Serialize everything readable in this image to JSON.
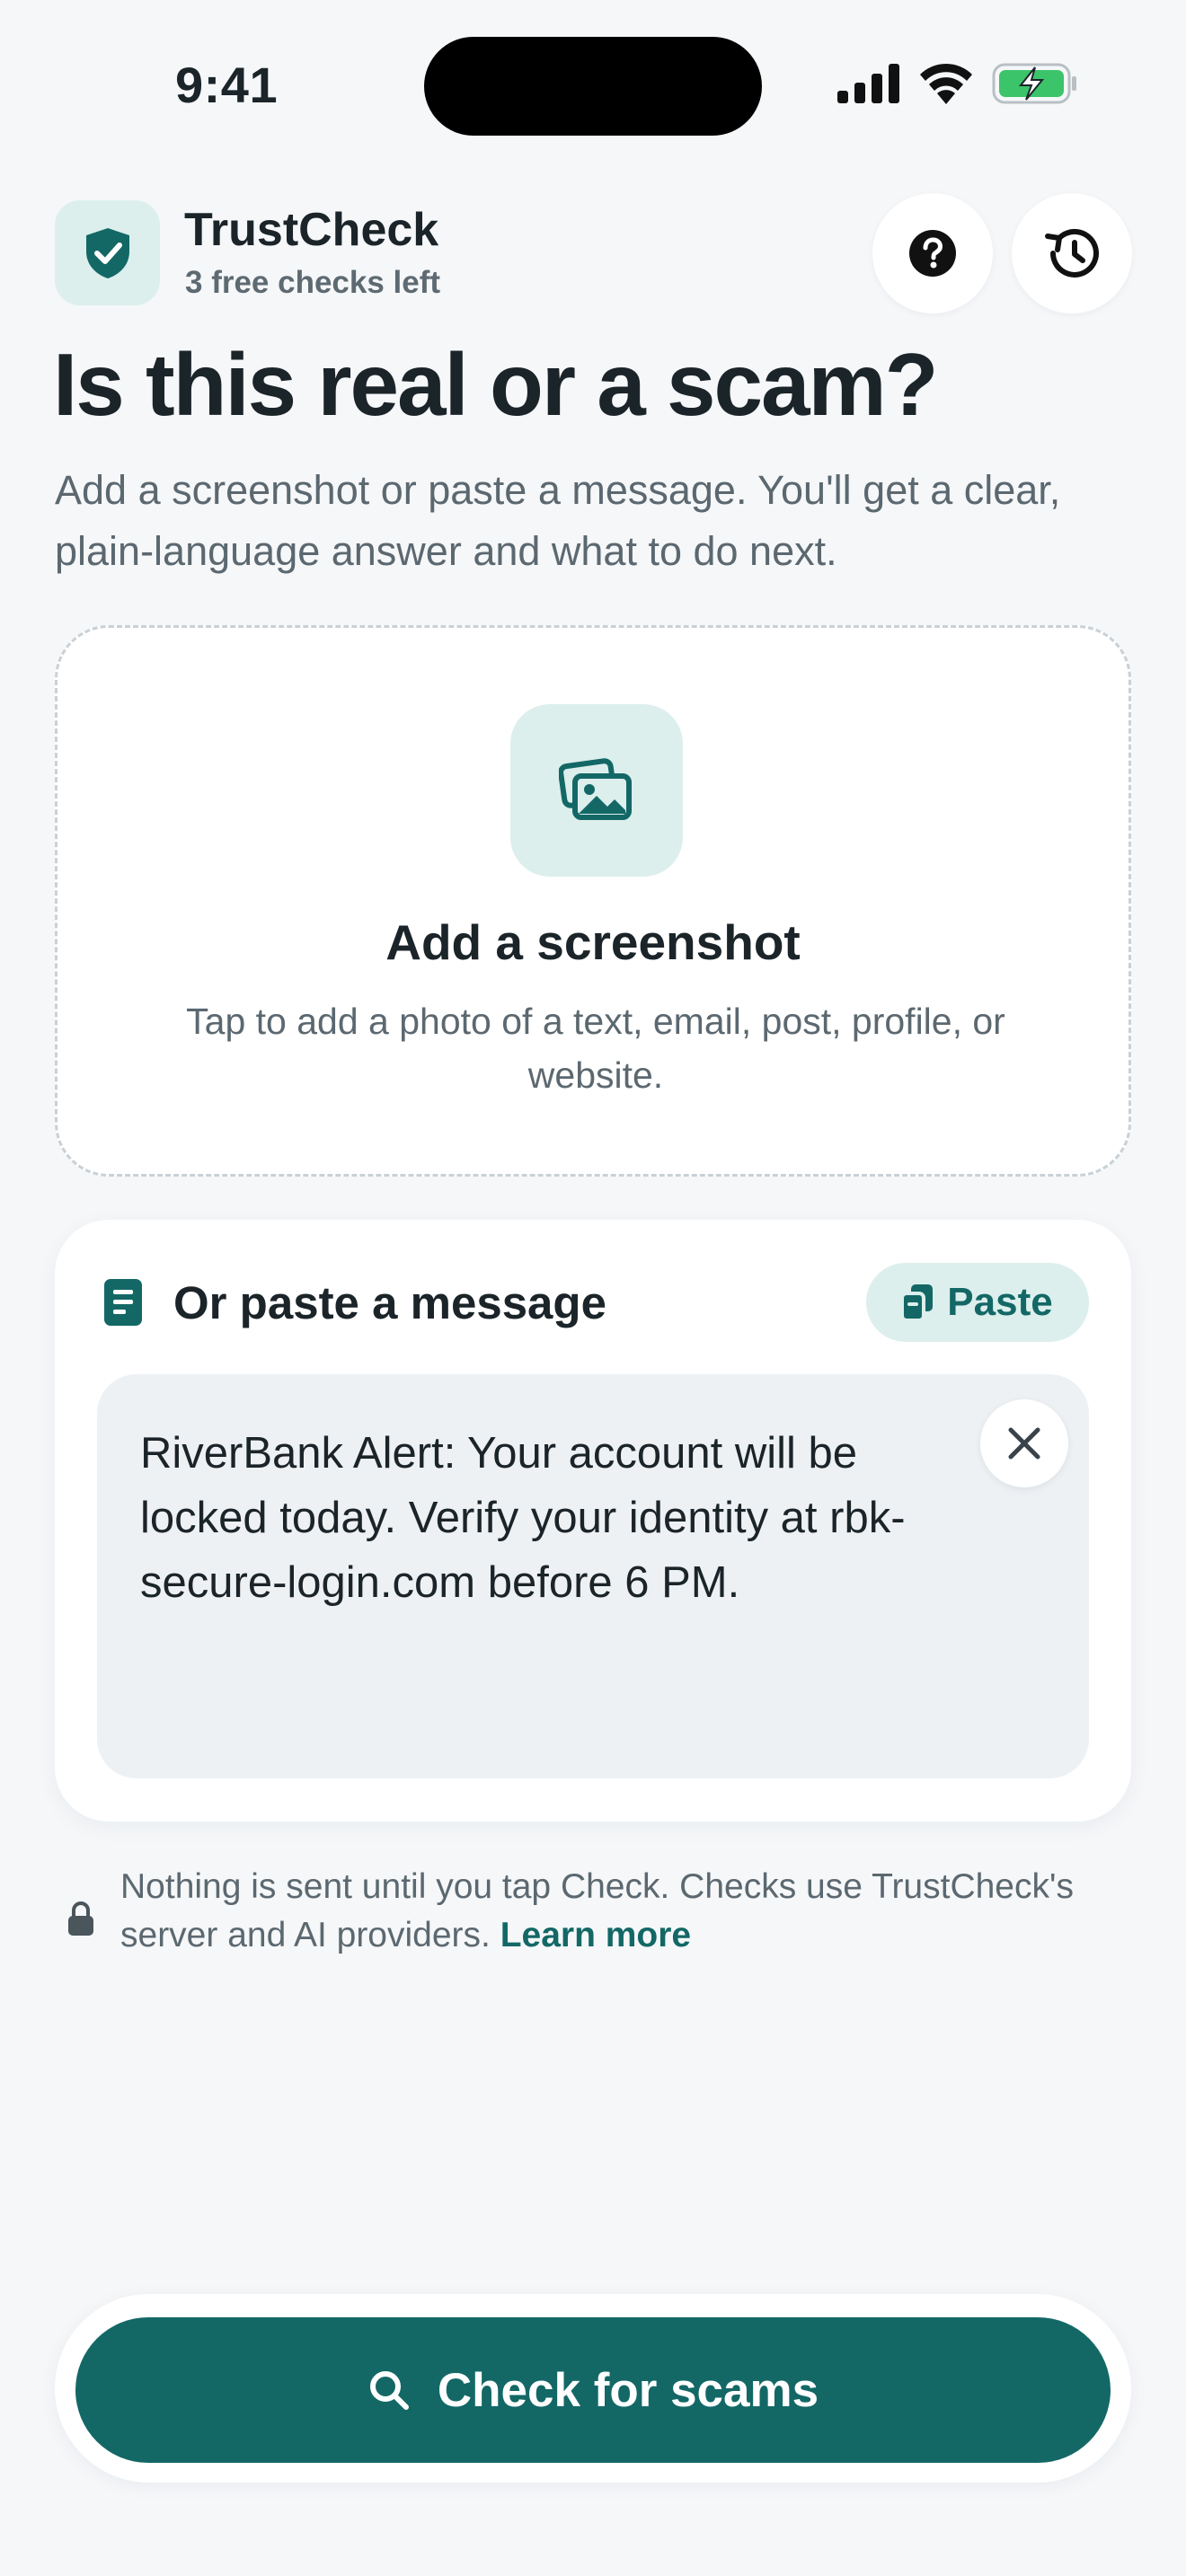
{
  "status_bar": {
    "time": "9:41"
  },
  "header": {
    "app_name": "TrustCheck",
    "subtitle": "3 free checks left",
    "logo_icon": "shield-check-icon",
    "help_icon": "question-circle-icon",
    "history_icon": "history-clock-icon"
  },
  "main": {
    "headline": "Is this real or a scam?",
    "intro": "Add a screenshot or paste a message. You'll get a clear, plain-language answer and what to do next."
  },
  "upload": {
    "icon": "photos-icon",
    "title": "Add a screenshot",
    "description": "Tap to add a photo of a text, email, post, profile, or website."
  },
  "paste": {
    "icon": "document-icon",
    "title": "Or paste a message",
    "paste_label": "Paste",
    "message": "RiverBank Alert: Your account will be locked today. Verify your identity at rbk-secure-login.com before 6 PM."
  },
  "privacy": {
    "text": "Nothing is sent until you tap Check. Checks use TrustCheck's server and AI providers.",
    "link": "Learn more"
  },
  "action": {
    "label": "Check for scams",
    "icon": "search-icon"
  },
  "colors": {
    "accent": "#136866",
    "accent_tint": "#dcefed",
    "background": "#f5f7f9",
    "text": "#1b2429",
    "muted": "#5c6870"
  }
}
